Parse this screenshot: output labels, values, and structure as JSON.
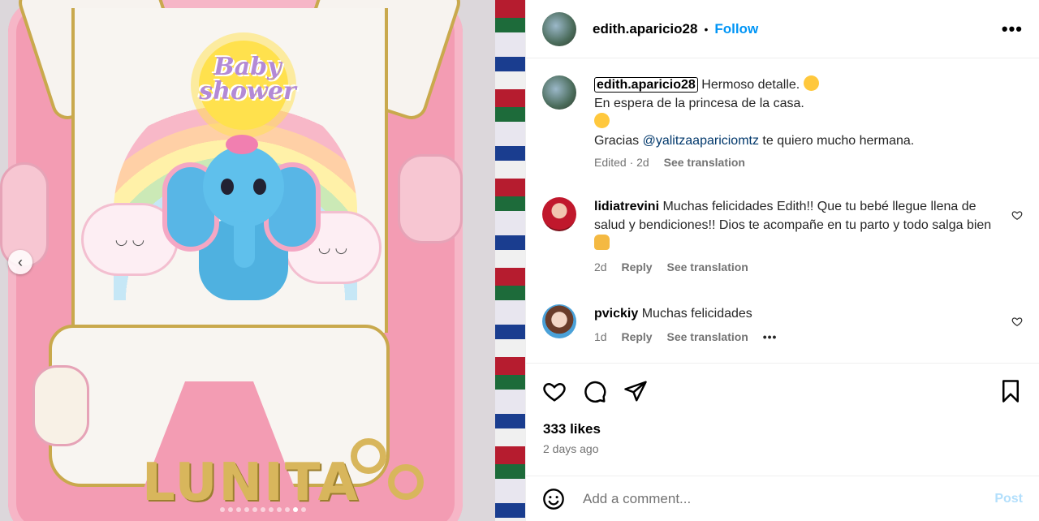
{
  "media": {
    "print_text": "Baby shower",
    "plaque_text": "LUNITA",
    "carousel_dots": 11,
    "carousel_active_index": 9
  },
  "header": {
    "username": "edith.aparicio28",
    "separator": "•",
    "follow_label": "Follow",
    "more_label": "•••"
  },
  "caption": {
    "username": "edith.aparicio28",
    "line1": "Hermoso detalle.",
    "line2": "En espera de la princesa de la casa.",
    "line3_prefix": "Gracias ",
    "mention": "@yalitzaapariciomtz",
    "line3_suffix": " te quiero mucho hermana.",
    "edited": "Edited · 2d",
    "see_translation": "See translation"
  },
  "comments": [
    {
      "username": "lidiatrevini",
      "text": " Muchas felicidades Edith!! Que tu bebé llegue llena de salud y bendiciones!! Dios te acompañe en tu parto y todo salga bien",
      "time": "2d",
      "reply": "Reply",
      "see_translation": "See translation"
    },
    {
      "username": "pvickiy",
      "text": " Muchas felicidades",
      "time": "1d",
      "reply": "Reply",
      "see_translation": "See translation",
      "more": "•••"
    }
  ],
  "stats": {
    "likes": "333 likes",
    "posted": "2 days ago"
  },
  "composer": {
    "placeholder": "Add a comment...",
    "post_label": "Post"
  },
  "colors": {
    "link": "#0095f6",
    "post_disabled": "#b2dffc",
    "muted": "#737373"
  }
}
